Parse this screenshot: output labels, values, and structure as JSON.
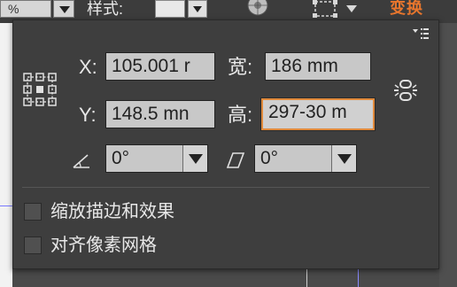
{
  "toolbar": {
    "left_field_value": "%",
    "style_label": "样式:",
    "transform_label": "变换"
  },
  "panel": {
    "x_label": "X:",
    "x_value": "105.001 r",
    "y_label": "Y:",
    "y_value": "148.5 mn",
    "width_label": "宽:",
    "width_value": "186 mm",
    "height_label": "高:",
    "height_value": "297-30 m",
    "rotate_value": "0°",
    "shear_value": "0°",
    "scale_strokes_label": "缩放描边和效果",
    "align_pixel_grid_label": "对齐像素网格",
    "scale_strokes_checked": false,
    "align_pixel_grid_checked": false
  },
  "colors": {
    "panel_bg": "#3e3e3e",
    "field_bg": "#c8c8c8",
    "focus_accent": "#e08a3c",
    "transform_label": "#e8762d"
  },
  "icons": {
    "reference_point": "reference-point-grid-icon",
    "constrain": "link-proportions-icon",
    "rotate": "angle-icon",
    "shear": "shear-icon",
    "panel_menu": "panel-menu-icon"
  }
}
